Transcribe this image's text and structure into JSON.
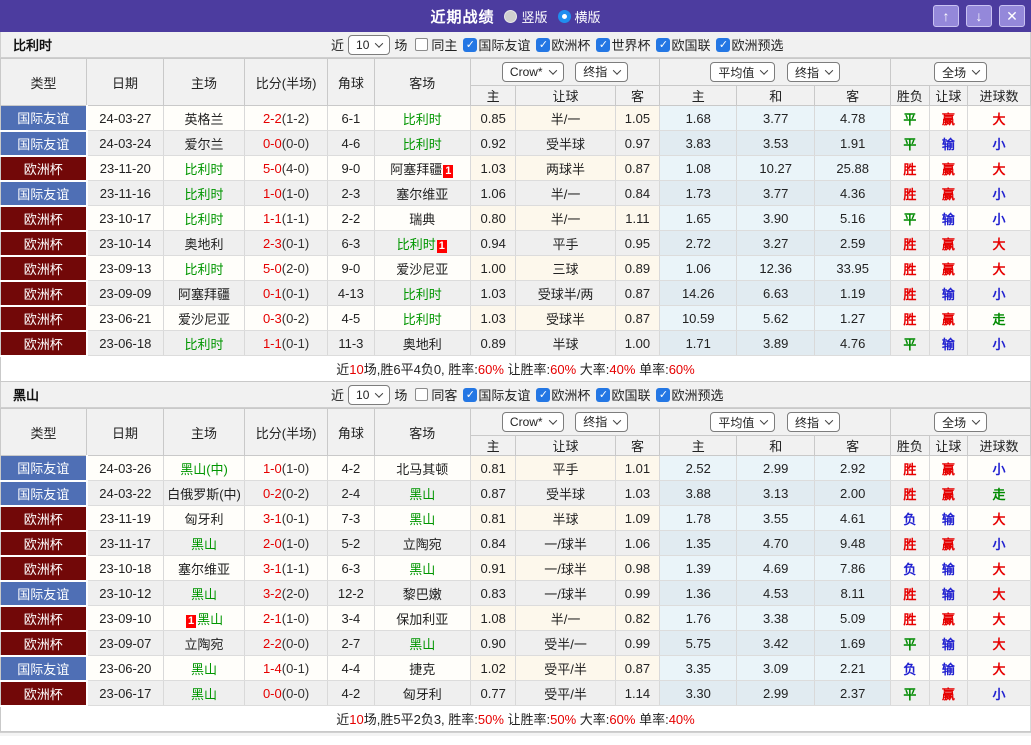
{
  "title_bar": {
    "title": "近期战绩",
    "radio_vertical": "竖版",
    "radio_horizontal": "横版",
    "up_button": "↑",
    "down_button": "↓",
    "close_button": "✕"
  },
  "controls": {
    "recent_prefix": "近",
    "recent_count": "10",
    "recent_suffix": "场",
    "odds_dropdown": "Crow*",
    "final_dropdown": "终指",
    "avg_dropdown": "平均值",
    "final_dropdown2": "终指",
    "scope_dropdown": "全场"
  },
  "columns": {
    "type": "类型",
    "date": "日期",
    "home": "主场",
    "score": "比分(半场)",
    "corner": "角球",
    "away": "客场",
    "odds_home": "主",
    "odds_handicap": "让球",
    "odds_away": "客",
    "avg_home": "主",
    "avg_draw": "和",
    "avg_away": "客",
    "result_wdl": "胜负",
    "result_handicap": "让球",
    "result_goals": "进球数"
  },
  "colors": {
    "accent_purple": "#4c3c9f",
    "type_friendly_blue": "#4f6fb5",
    "type_eurocup_maroon": "#720808",
    "team_green": "#009600",
    "win_red": "#e60000",
    "lose_blue": "#2020d0",
    "push_green": "#008a00",
    "badge_red": "#ff0000"
  },
  "sections": [
    {
      "team": "比利时",
      "filter": {
        "same_label": "同主",
        "same_checked": false,
        "leagues": [
          "国际友谊",
          "欧洲杯",
          "世界杯",
          "欧国联",
          "欧洲预选"
        ]
      },
      "rows": [
        {
          "lg": "国际友谊",
          "lgc": "f",
          "date": "24-03-27",
          "home": "英格兰",
          "hg": false,
          "hb": "",
          "hbb": false,
          "ft": "2-2",
          "ht": "(1-2)",
          "cor": "6-1",
          "away": "比利时",
          "ag": true,
          "ab": "",
          "oh": "0.85",
          "hc": "半/一",
          "oa": "1.05",
          "ah": "1.68",
          "ad": "3.77",
          "aa": "4.78",
          "r1": "平",
          "r1c": "g",
          "r2": "赢",
          "r2c": "r",
          "r3": "大",
          "r3c": "r"
        },
        {
          "lg": "国际友谊",
          "lgc": "f",
          "date": "24-03-24",
          "home": "爱尔兰",
          "hg": false,
          "hb": "",
          "hbb": false,
          "ft": "0-0",
          "ht": "(0-0)",
          "cor": "4-6",
          "away": "比利时",
          "ag": true,
          "ab": "",
          "oh": "0.92",
          "hc": "受半球",
          "oa": "0.97",
          "ah": "3.83",
          "ad": "3.53",
          "aa": "1.91",
          "r1": "平",
          "r1c": "g",
          "r2": "输",
          "r2c": "b",
          "r3": "小",
          "r3c": "b"
        },
        {
          "lg": "欧洲杯",
          "lgc": "e",
          "date": "23-11-20",
          "home": "比利时",
          "hg": true,
          "hb": "",
          "hbb": false,
          "ft": "5-0",
          "ht": "(4-0)",
          "cor": "9-0",
          "away": "阿塞拜疆",
          "ag": false,
          "ab": "1",
          "oh": "1.03",
          "hc": "两球半",
          "oa": "0.87",
          "ah": "1.08",
          "ad": "10.27",
          "aa": "25.88",
          "r1": "胜",
          "r1c": "r",
          "r2": "赢",
          "r2c": "r",
          "r3": "大",
          "r3c": "r"
        },
        {
          "lg": "国际友谊",
          "lgc": "f",
          "date": "23-11-16",
          "home": "比利时",
          "hg": true,
          "hb": "",
          "hbb": false,
          "ft": "1-0",
          "ht": "(1-0)",
          "cor": "2-3",
          "away": "塞尔维亚",
          "ag": false,
          "ab": "",
          "oh": "1.06",
          "hc": "半/一",
          "oa": "0.84",
          "ah": "1.73",
          "ad": "3.77",
          "aa": "4.36",
          "r1": "胜",
          "r1c": "r",
          "r2": "赢",
          "r2c": "r",
          "r3": "小",
          "r3c": "b"
        },
        {
          "lg": "欧洲杯",
          "lgc": "e",
          "date": "23-10-17",
          "home": "比利时",
          "hg": true,
          "hb": "",
          "hbb": false,
          "ft": "1-1",
          "ht": "(1-1)",
          "cor": "2-2",
          "away": "瑞典",
          "ag": false,
          "ab": "",
          "oh": "0.80",
          "hc": "半/一",
          "oa": "1.11",
          "ah": "1.65",
          "ad": "3.90",
          "aa": "5.16",
          "r1": "平",
          "r1c": "g",
          "r2": "输",
          "r2c": "b",
          "r3": "小",
          "r3c": "b"
        },
        {
          "lg": "欧洲杯",
          "lgc": "e",
          "date": "23-10-14",
          "home": "奥地利",
          "hg": false,
          "hb": "",
          "hbb": false,
          "ft": "2-3",
          "ht": "(0-1)",
          "cor": "6-3",
          "away": "比利时",
          "ag": true,
          "ab": "1",
          "oh": "0.94",
          "hc": "平手",
          "oa": "0.95",
          "ah": "2.72",
          "ad": "3.27",
          "aa": "2.59",
          "r1": "胜",
          "r1c": "r",
          "r2": "赢",
          "r2c": "r",
          "r3": "大",
          "r3c": "r"
        },
        {
          "lg": "欧洲杯",
          "lgc": "e",
          "date": "23-09-13",
          "home": "比利时",
          "hg": true,
          "hb": "",
          "hbb": false,
          "ft": "5-0",
          "ht": "(2-0)",
          "cor": "9-0",
          "away": "爱沙尼亚",
          "ag": false,
          "ab": "",
          "oh": "1.00",
          "hc": "三球",
          "oa": "0.89",
          "ah": "1.06",
          "ad": "12.36",
          "aa": "33.95",
          "r1": "胜",
          "r1c": "r",
          "r2": "赢",
          "r2c": "r",
          "r3": "大",
          "r3c": "r"
        },
        {
          "lg": "欧洲杯",
          "lgc": "e",
          "date": "23-09-09",
          "home": "阿塞拜疆",
          "hg": false,
          "hb": "",
          "hbb": false,
          "ft": "0-1",
          "ht": "(0-1)",
          "cor": "4-13",
          "away": "比利时",
          "ag": true,
          "ab": "",
          "oh": "1.03",
          "hc": "受球半/两",
          "oa": "0.87",
          "ah": "14.26",
          "ad": "6.63",
          "aa": "1.19",
          "r1": "胜",
          "r1c": "r",
          "r2": "输",
          "r2c": "b",
          "r3": "小",
          "r3c": "b"
        },
        {
          "lg": "欧洲杯",
          "lgc": "e",
          "date": "23-06-21",
          "home": "爱沙尼亚",
          "hg": false,
          "hb": "",
          "hbb": false,
          "ft": "0-3",
          "ht": "(0-2)",
          "cor": "4-5",
          "away": "比利时",
          "ag": true,
          "ab": "",
          "oh": "1.03",
          "hc": "受球半",
          "oa": "0.87",
          "ah": "10.59",
          "ad": "5.62",
          "aa": "1.27",
          "r1": "胜",
          "r1c": "r",
          "r2": "赢",
          "r2c": "r",
          "r3": "走",
          "r3c": "g"
        },
        {
          "lg": "欧洲杯",
          "lgc": "e",
          "date": "23-06-18",
          "home": "比利时",
          "hg": true,
          "hb": "",
          "hbb": false,
          "ft": "1-1",
          "ht": "(0-1)",
          "cor": "11-3",
          "away": "奥地利",
          "ag": false,
          "ab": "",
          "oh": "0.89",
          "hc": "半球",
          "oa": "1.00",
          "ah": "1.71",
          "ad": "3.89",
          "aa": "4.76",
          "r1": "平",
          "r1c": "g",
          "r2": "输",
          "r2c": "b",
          "r3": "小",
          "r3c": "b"
        }
      ],
      "summary": {
        "pre": "近",
        "games": "10",
        "mid": "场,胜6平4负0, 胜率:",
        "v1": "60%",
        "l2": " 让胜率:",
        "v2": "60%",
        "l3": " 大率:",
        "v3": "40%",
        "l4": " 单率:",
        "v4": "60%"
      }
    },
    {
      "team": "黑山",
      "filter": {
        "same_label": "同客",
        "same_checked": false,
        "leagues": [
          "国际友谊",
          "欧洲杯",
          "欧国联",
          "欧洲预选"
        ]
      },
      "rows": [
        {
          "lg": "国际友谊",
          "lgc": "f",
          "date": "24-03-26",
          "home": "黑山(中)",
          "hg": true,
          "hb": "",
          "hbb": false,
          "ft": "1-0",
          "ht": "(1-0)",
          "cor": "4-2",
          "away": "北马其顿",
          "ag": false,
          "ab": "",
          "oh": "0.81",
          "hc": "平手",
          "oa": "1.01",
          "ah": "2.52",
          "ad": "2.99",
          "aa": "2.92",
          "r1": "胜",
          "r1c": "r",
          "r2": "赢",
          "r2c": "r",
          "r3": "小",
          "r3c": "b"
        },
        {
          "lg": "国际友谊",
          "lgc": "f",
          "date": "24-03-22",
          "home": "白俄罗斯(中)",
          "hg": false,
          "hb": "",
          "hbb": false,
          "ft": "0-2",
          "ht": "(0-2)",
          "cor": "2-4",
          "away": "黑山",
          "ag": true,
          "ab": "",
          "oh": "0.87",
          "hc": "受半球",
          "oa": "1.03",
          "ah": "3.88",
          "ad": "3.13",
          "aa": "2.00",
          "r1": "胜",
          "r1c": "r",
          "r2": "赢",
          "r2c": "r",
          "r3": "走",
          "r3c": "g"
        },
        {
          "lg": "欧洲杯",
          "lgc": "e",
          "date": "23-11-19",
          "home": "匈牙利",
          "hg": false,
          "hb": "",
          "hbb": false,
          "ft": "3-1",
          "ht": "(0-1)",
          "cor": "7-3",
          "away": "黑山",
          "ag": true,
          "ab": "",
          "oh": "0.81",
          "hc": "半球",
          "oa": "1.09",
          "ah": "1.78",
          "ad": "3.55",
          "aa": "4.61",
          "r1": "负",
          "r1c": "b",
          "r2": "输",
          "r2c": "b",
          "r3": "大",
          "r3c": "r"
        },
        {
          "lg": "欧洲杯",
          "lgc": "e",
          "date": "23-11-17",
          "home": "黑山",
          "hg": true,
          "hb": "",
          "hbb": false,
          "ft": "2-0",
          "ht": "(1-0)",
          "cor": "5-2",
          "away": "立陶宛",
          "ag": false,
          "ab": "",
          "oh": "0.84",
          "hc": "一/球半",
          "oa": "1.06",
          "ah": "1.35",
          "ad": "4.70",
          "aa": "9.48",
          "r1": "胜",
          "r1c": "r",
          "r2": "赢",
          "r2c": "r",
          "r3": "小",
          "r3c": "b"
        },
        {
          "lg": "欧洲杯",
          "lgc": "e",
          "date": "23-10-18",
          "home": "塞尔维亚",
          "hg": false,
          "hb": "",
          "hbb": false,
          "ft": "3-1",
          "ht": "(1-1)",
          "cor": "6-3",
          "away": "黑山",
          "ag": true,
          "ab": "",
          "oh": "0.91",
          "hc": "一/球半",
          "oa": "0.98",
          "ah": "1.39",
          "ad": "4.69",
          "aa": "7.86",
          "r1": "负",
          "r1c": "b",
          "r2": "输",
          "r2c": "b",
          "r3": "大",
          "r3c": "r"
        },
        {
          "lg": "国际友谊",
          "lgc": "f",
          "date": "23-10-12",
          "home": "黑山",
          "hg": true,
          "hb": "",
          "hbb": false,
          "ft": "3-2",
          "ht": "(2-0)",
          "cor": "12-2",
          "away": "黎巴嫩",
          "ag": false,
          "ab": "",
          "oh": "0.83",
          "hc": "一/球半",
          "oa": "0.99",
          "ah": "1.36",
          "ad": "4.53",
          "aa": "8.11",
          "r1": "胜",
          "r1c": "r",
          "r2": "输",
          "r2c": "b",
          "r3": "大",
          "r3c": "r"
        },
        {
          "lg": "欧洲杯",
          "lgc": "e",
          "date": "23-09-10",
          "home": "黑山",
          "hg": true,
          "hb": "1",
          "hbb": true,
          "ft": "2-1",
          "ht": "(1-0)",
          "cor": "3-4",
          "away": "保加利亚",
          "ag": false,
          "ab": "",
          "oh": "1.08",
          "hc": "半/一",
          "oa": "0.82",
          "ah": "1.76",
          "ad": "3.38",
          "aa": "5.09",
          "r1": "胜",
          "r1c": "r",
          "r2": "赢",
          "r2c": "r",
          "r3": "大",
          "r3c": "r"
        },
        {
          "lg": "欧洲杯",
          "lgc": "e",
          "date": "23-09-07",
          "home": "立陶宛",
          "hg": false,
          "hb": "",
          "hbb": false,
          "ft": "2-2",
          "ht": "(0-0)",
          "cor": "2-7",
          "away": "黑山",
          "ag": true,
          "ab": "",
          "oh": "0.90",
          "hc": "受半/一",
          "oa": "0.99",
          "ah": "5.75",
          "ad": "3.42",
          "aa": "1.69",
          "r1": "平",
          "r1c": "g",
          "r2": "输",
          "r2c": "b",
          "r3": "大",
          "r3c": "r"
        },
        {
          "lg": "国际友谊",
          "lgc": "f",
          "date": "23-06-20",
          "home": "黑山",
          "hg": true,
          "hb": "",
          "hbb": false,
          "ft": "1-4",
          "ht": "(0-1)",
          "cor": "4-4",
          "away": "捷克",
          "ag": false,
          "ab": "",
          "oh": "1.02",
          "hc": "受平/半",
          "oa": "0.87",
          "ah": "3.35",
          "ad": "3.09",
          "aa": "2.21",
          "r1": "负",
          "r1c": "b",
          "r2": "输",
          "r2c": "b",
          "r3": "大",
          "r3c": "r"
        },
        {
          "lg": "欧洲杯",
          "lgc": "e",
          "date": "23-06-17",
          "home": "黑山",
          "hg": true,
          "hb": "",
          "hbb": false,
          "ft": "0-0",
          "ht": "(0-0)",
          "cor": "4-2",
          "away": "匈牙利",
          "ag": false,
          "ab": "",
          "oh": "0.77",
          "hc": "受平/半",
          "oa": "1.14",
          "ah": "3.30",
          "ad": "2.99",
          "aa": "2.37",
          "r1": "平",
          "r1c": "g",
          "r2": "赢",
          "r2c": "r",
          "r3": "小",
          "r3c": "b"
        }
      ],
      "summary": {
        "pre": "近",
        "games": "10",
        "mid": "场,胜5平2负3, 胜率:",
        "v1": "50%",
        "l2": " 让胜率:",
        "v2": "50%",
        "l3": " 大率:",
        "v3": "60%",
        "l4": " 单率:",
        "v4": "40%"
      }
    }
  ]
}
